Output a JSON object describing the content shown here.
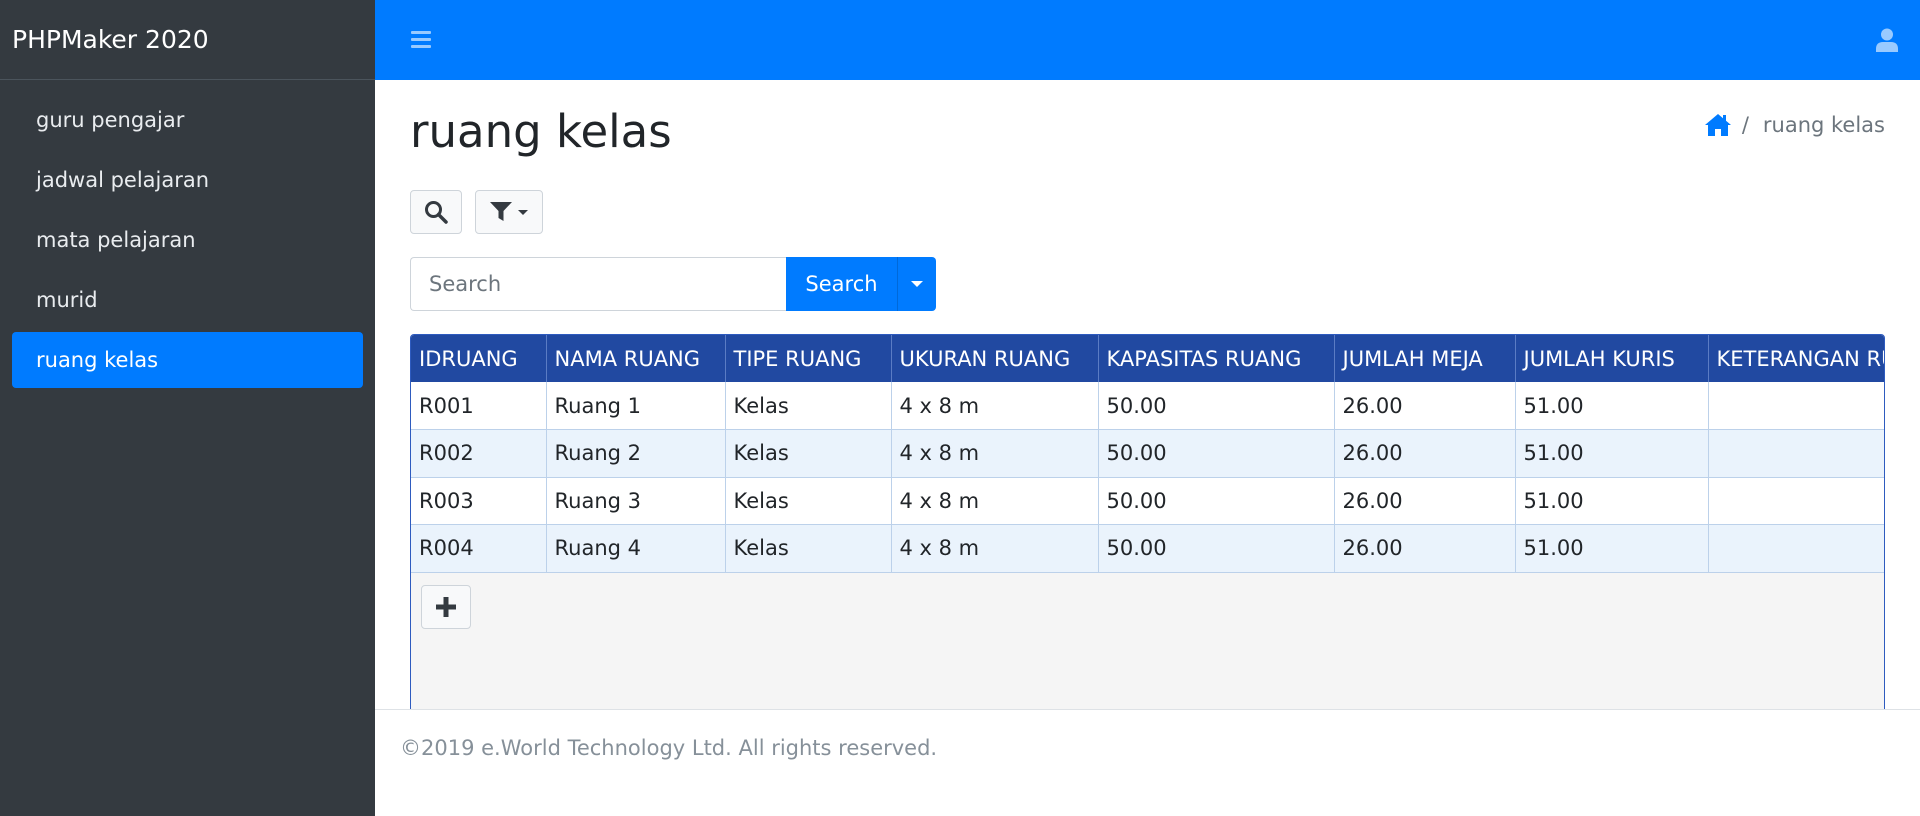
{
  "app": {
    "brand": "PHPMaker 2020"
  },
  "sidebar": {
    "items": [
      {
        "label": "guru pengajar",
        "active": false
      },
      {
        "label": "jadwal pelajaran",
        "active": false
      },
      {
        "label": "mata pelajaran",
        "active": false
      },
      {
        "label": "murid",
        "active": false
      },
      {
        "label": "ruang kelas",
        "active": true
      }
    ]
  },
  "topbar": {
    "menu_icon": "hamburger-menu-icon",
    "user_icon": "user-icon"
  },
  "page": {
    "title": "ruang kelas",
    "breadcrumb": {
      "home_icon": "home-icon",
      "current": "ruang kelas",
      "separator": "/"
    }
  },
  "toolbar": {
    "search_toggle_icon": "search-icon",
    "filter_icon": "filter-icon"
  },
  "search": {
    "placeholder": "Search",
    "value": "",
    "button_label": "Search",
    "dropdown_icon": "caret-down-icon"
  },
  "table": {
    "columns": [
      "IDRUANG",
      "NAMA RUANG",
      "TIPE RUANG",
      "UKURAN RUANG",
      "KAPASITAS RUANG",
      "JUMLAH MEJA",
      "JUMLAH KURIS",
      "KETERANGAN RUANG"
    ],
    "rows": [
      [
        "R001",
        "Ruang 1",
        "Kelas",
        "4 x 8 m",
        "50.00",
        "26.00",
        "51.00",
        ""
      ],
      [
        "R002",
        "Ruang 2",
        "Kelas",
        "4 x 8 m",
        "50.00",
        "26.00",
        "51.00",
        ""
      ],
      [
        "R003",
        "Ruang 3",
        "Kelas",
        "4 x 8 m",
        "50.00",
        "26.00",
        "51.00",
        ""
      ],
      [
        "R004",
        "Ruang 4",
        "Kelas",
        "4 x 8 m",
        "50.00",
        "26.00",
        "51.00",
        ""
      ]
    ],
    "add_icon": "plus-icon"
  },
  "footer": {
    "text": "©2019 e.World Technology Ltd. All rights reserved."
  },
  "colors": {
    "primary": "#007bff",
    "sidebar_bg": "#343a40",
    "table_header_bg": "#2149a1",
    "row_alt_bg": "#eaf3fc"
  }
}
